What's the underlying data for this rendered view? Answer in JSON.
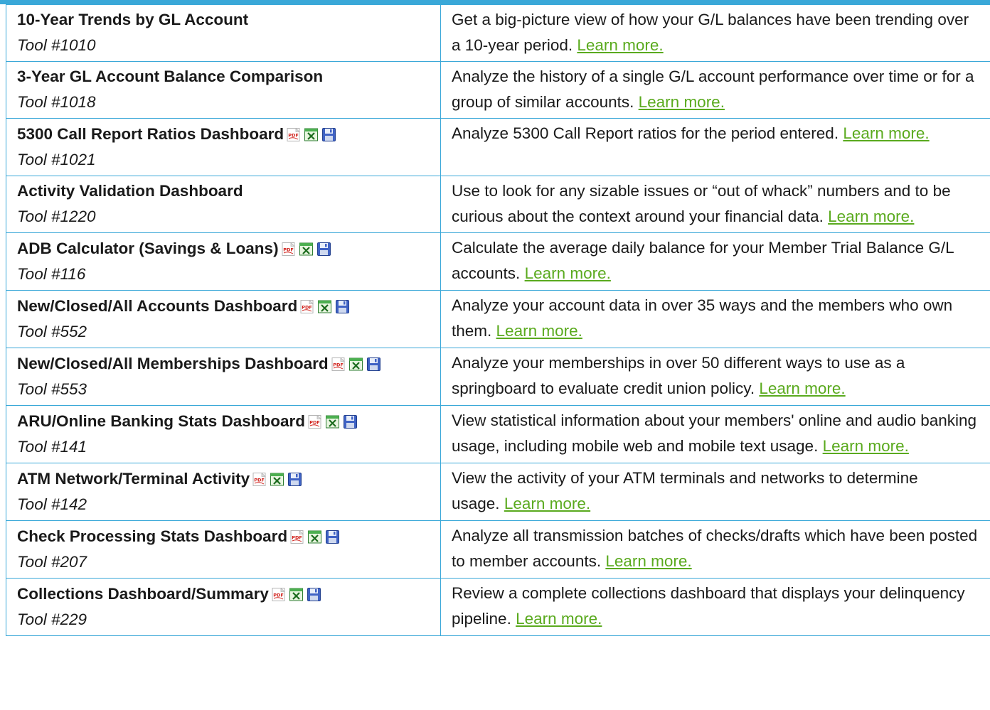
{
  "link_color": "#5aaa1e",
  "border_color": "#3aa8d8",
  "tools": [
    {
      "name": "10-Year Trends by GL Account",
      "number": "Tool #1010",
      "icons": false,
      "description": "Get a big-picture view of how your G/L balances have been trending over a 10-year period.",
      "link": "Learn more."
    },
    {
      "name": "3-Year GL Account Balance Comparison",
      "number": "Tool #1018",
      "icons": false,
      "description": "Analyze the history of a single G/L account performance over time or for a group of similar accounts.",
      "link": "Learn more."
    },
    {
      "name": "5300 Call Report Ratios Dashboard",
      "number": "Tool #1021",
      "icons": true,
      "description": "Analyze 5300 Call Report ratios for the period entered.",
      "link": "Learn more."
    },
    {
      "name": "Activity Validation Dashboard",
      "number": "Tool #1220",
      "icons": false,
      "description": "Use to look for any sizable issues or “out of whack” numbers and to be curious about the context around your financial data.",
      "link": "Learn more."
    },
    {
      "name": "ADB Calculator (Savings & Loans)",
      "number": "Tool #116",
      "icons": true,
      "description": "Calculate the average daily balance for your Member Trial Balance G/L accounts.",
      "link": "Learn more."
    },
    {
      "name": "New/Closed/All Accounts Dashboard",
      "number": "Tool #552",
      "icons": true,
      "description": "Analyze your account data in over 35 ways and the members who own them.",
      "link": "Learn more."
    },
    {
      "name": "New/Closed/All Memberships Dashboard",
      "number": "Tool #553",
      "icons": true,
      "description": "Analyze your memberships in over 50 different ways to use as a springboard to evaluate credit union policy.",
      "link": "Learn more."
    },
    {
      "name": "ARU/Online Banking Stats Dashboard",
      "number": "Tool #141",
      "icons": true,
      "description": "View statistical information about your members' online and audio banking usage, including mobile web and mobile text usage.",
      "link": "Learn more."
    },
    {
      "name": "ATM Network/Terminal Activity",
      "number": "Tool #142",
      "icons": true,
      "description": "View the activity of your ATM terminals and networks to determine usage.",
      "link": "Learn more."
    },
    {
      "name": "Check Processing Stats Dashboard",
      "number": "Tool #207",
      "icons": true,
      "description": "Analyze all transmission batches of checks/drafts which have been posted to member accounts.",
      "link": "Learn more."
    },
    {
      "name": "Collections Dashboard/Summary",
      "number": "Tool #229",
      "icons": true,
      "description": "Review a complete collections dashboard that displays your delinquency pipeline.",
      "link": "Learn more."
    }
  ]
}
